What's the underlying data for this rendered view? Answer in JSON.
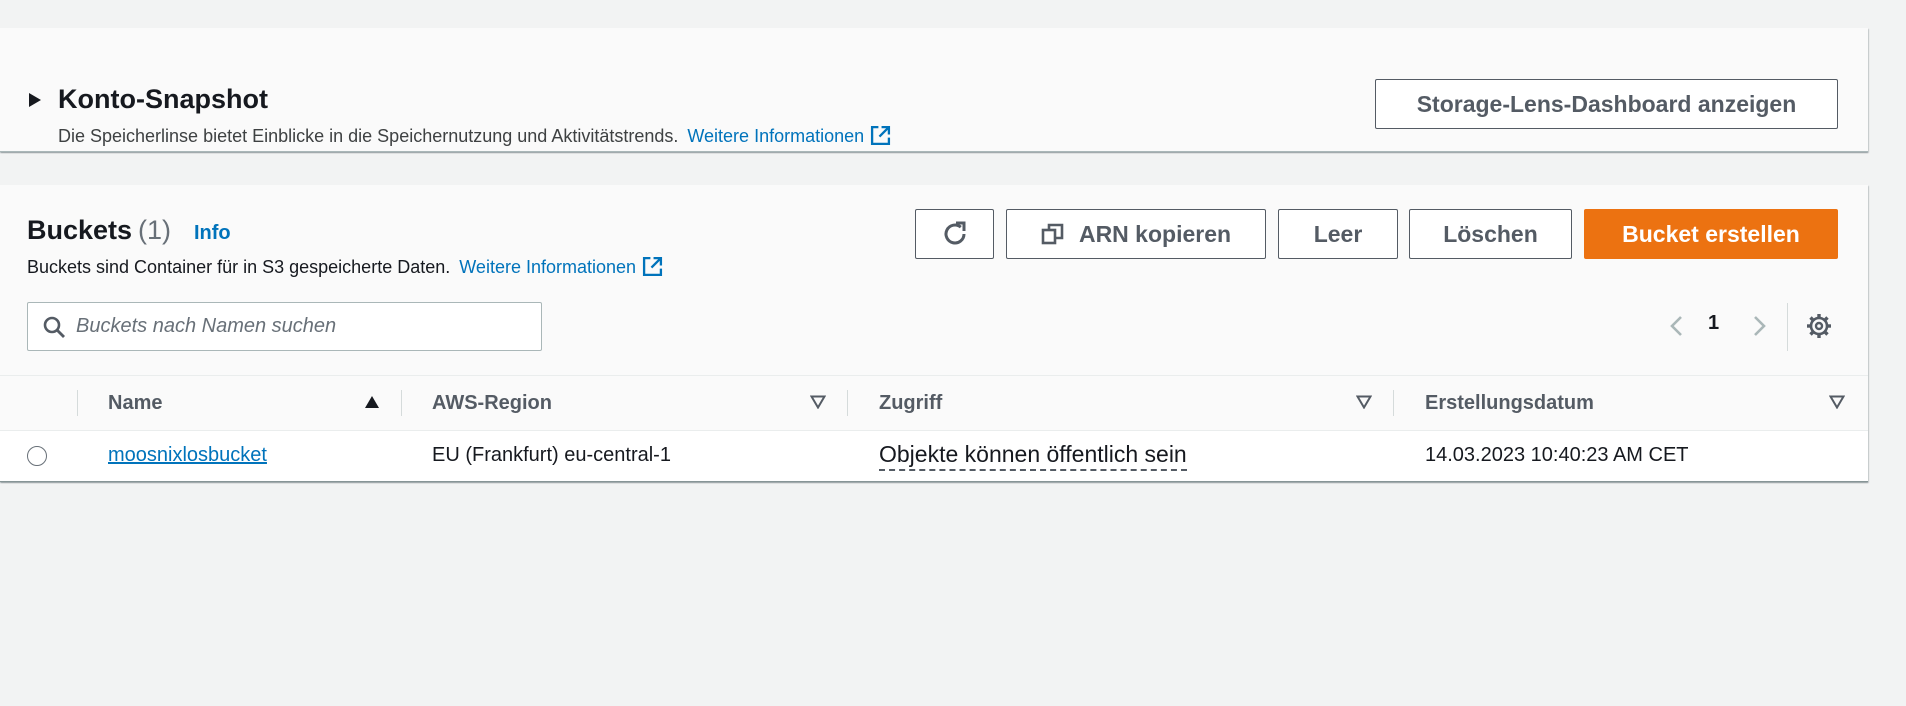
{
  "snapshot": {
    "title": "Konto-Snapshot",
    "description": "Die Speicherlinse bietet Einblicke in die Speichernutzung und Aktivitätstrends.",
    "more_info_link": "Weitere Informationen",
    "storage_lens_button": "Storage-Lens-Dashboard anzeigen"
  },
  "buckets": {
    "title": "Buckets",
    "count": "(1)",
    "info_link": "Info",
    "description": "Buckets sind Container für in S3 gespeicherte Daten.",
    "more_info_link": "Weitere Informationen",
    "actions": {
      "refresh_icon": "refresh-icon",
      "copy_arn": "ARN kopieren",
      "empty": "Leer",
      "delete": "Löschen",
      "create": "Bucket erstellen"
    },
    "search": {
      "placeholder": "Buckets nach Namen suchen",
      "value": ""
    },
    "pagination": {
      "current_page": "1"
    },
    "table": {
      "columns": [
        "Name",
        "AWS-Region",
        "Zugriff",
        "Erstellungsdatum"
      ],
      "rows": [
        {
          "name": "moosnixlosbucket",
          "region": "EU (Frankfurt) eu-central-1",
          "access": "Objekte können öffentlich sein",
          "created": "14.03.2023 10:40:23 AM CET"
        }
      ]
    }
  },
  "colors": {
    "page_bg": "#f2f3f3",
    "panel_bg": "#fafafa",
    "link": "#0073bb",
    "primary_button": "#ec7211",
    "button_border": "#545b64"
  }
}
